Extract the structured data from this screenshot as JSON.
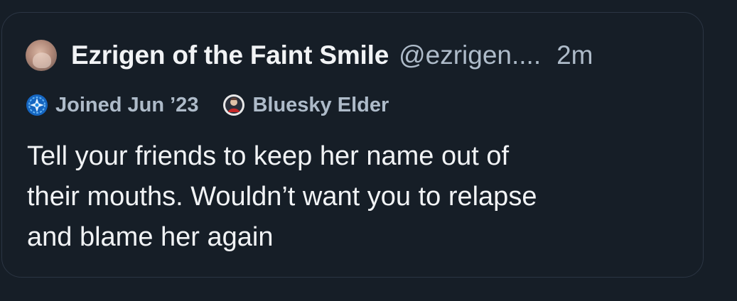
{
  "post": {
    "author": {
      "display_name": "Ezrigen of the Faint Smile",
      "handle": "@ezrigen....",
      "avatar_icon": "user-avatar"
    },
    "timestamp": "2m",
    "badges": [
      {
        "label": "Joined Jun ’23",
        "icon": "sparkle-globe-icon",
        "color": "#1e88e5"
      },
      {
        "label": "Bluesky Elder",
        "icon": "elder-badge-icon",
        "color": "#e0e0e0"
      }
    ],
    "text_lines": [
      "Tell your friends to keep her name out of",
      "their mouths. Wouldn’t want you to relapse",
      "and blame her again"
    ]
  },
  "colors": {
    "background": "#161e27",
    "card_border": "#2b3543",
    "primary_text": "#f1f3f5",
    "secondary_text": "#aebbc9"
  }
}
